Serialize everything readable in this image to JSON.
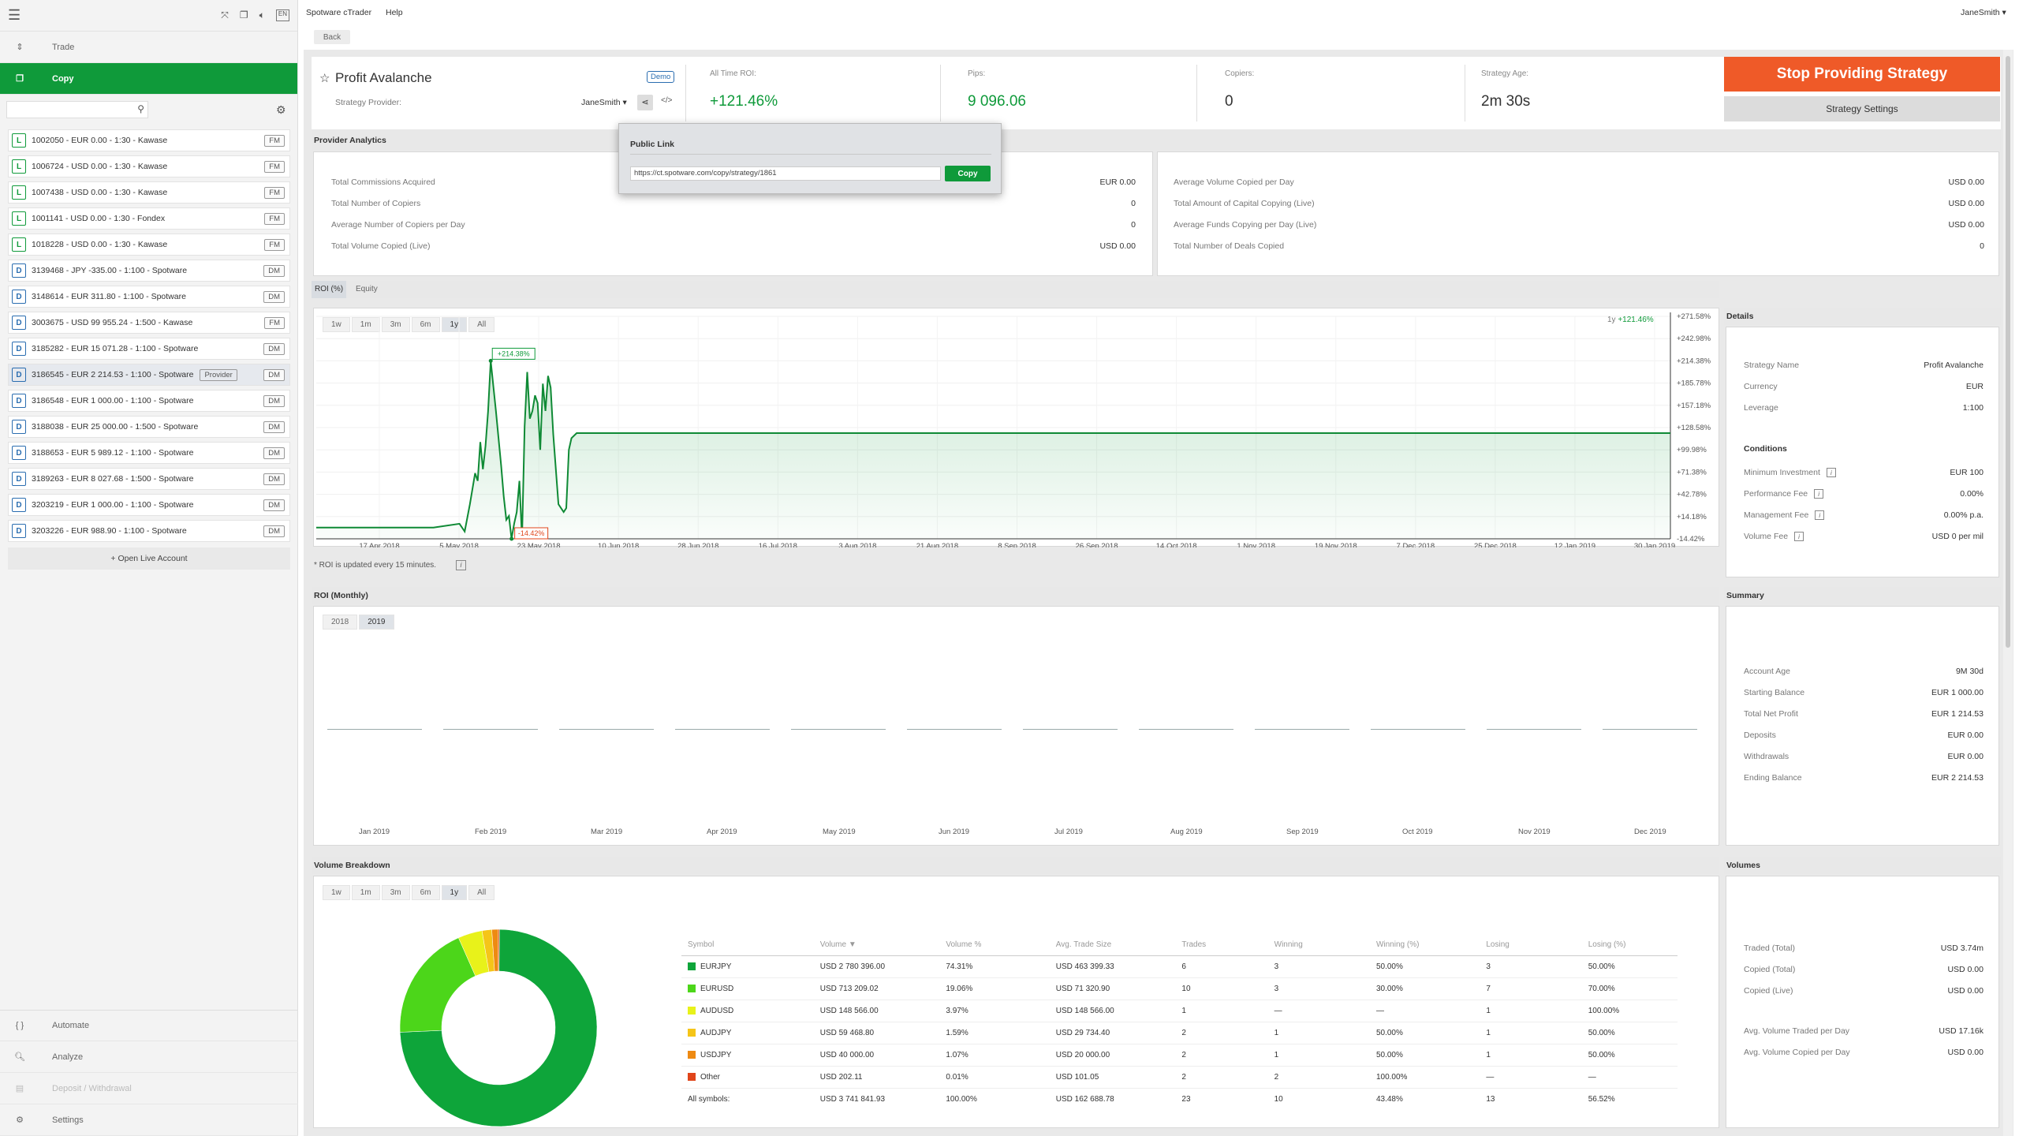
{
  "topbar": {
    "menu_app": "Spotware cTrader",
    "menu_help": "Help",
    "user": "JaneSmith"
  },
  "sidebar": {
    "nav": [
      {
        "label": "Trade"
      },
      {
        "label": "Copy"
      }
    ],
    "accounts": [
      {
        "type": "L",
        "label": "1002050 - EUR 0.00 - 1:30 - Kawase",
        "tag": "FM"
      },
      {
        "type": "L",
        "label": "1006724 - USD 0.00 - 1:30 - Kawase",
        "tag": "FM"
      },
      {
        "type": "L",
        "label": "1007438 - USD 0.00 - 1:30 - Kawase",
        "tag": "FM"
      },
      {
        "type": "L",
        "label": "1001141 - USD 0.00 - 1:30 - Fondex",
        "tag": "FM"
      },
      {
        "type": "L",
        "label": "1018228 - USD 0.00 - 1:30 - Kawase",
        "tag": "FM"
      },
      {
        "type": "D",
        "label": "3139468 - JPY -335.00 - 1:100 - Spotware",
        "tag": "DM"
      },
      {
        "type": "D",
        "label": "3148614 - EUR 311.80 - 1:100 - Spotware",
        "tag": "DM"
      },
      {
        "type": "D",
        "label": "3003675 - USD 99 955.24 - 1:500 - Kawase",
        "tag": "FM"
      },
      {
        "type": "D",
        "label": "3185282 - EUR 15 071.28 - 1:100 - Spotware",
        "tag": "DM"
      },
      {
        "type": "D",
        "label": "3186545 - EUR 2 214.53 - 1:100 - Spotware",
        "tag": "DM",
        "provider": "Provider"
      },
      {
        "type": "D",
        "label": "3186548 - EUR 1 000.00 - 1:100 - Spotware",
        "tag": "DM"
      },
      {
        "type": "D",
        "label": "3188038 - EUR 25 000.00 - 1:500 - Spotware",
        "tag": "DM"
      },
      {
        "type": "D",
        "label": "3188653 - EUR 5 989.12 - 1:100 - Spotware",
        "tag": "DM"
      },
      {
        "type": "D",
        "label": "3189263 - EUR 8 027.68 - 1:500 - Spotware",
        "tag": "DM"
      },
      {
        "type": "D",
        "label": "3203219 - EUR 1 000.00 - 1:100 - Spotware",
        "tag": "DM"
      },
      {
        "type": "D",
        "label": "3203226 - EUR 988.90 - 1:100 - Spotware",
        "tag": "DM"
      }
    ],
    "open_live": "+ Open Live Account",
    "bottom_nav": [
      {
        "label": "Automate"
      },
      {
        "label": "Analyze"
      },
      {
        "label": "Deposit / Withdrawal"
      },
      {
        "label": "Settings"
      }
    ]
  },
  "back": "Back",
  "header": {
    "title": "Profit Avalanche",
    "demo": "Demo",
    "provider_label": "Strategy Provider:",
    "provider_value": "JaneSmith",
    "roi_label": "All Time ROI:",
    "roi_value": "+121.46%",
    "pips_label": "Pips:",
    "pips_value": "9 096.06",
    "copiers_label": "Copiers:",
    "copiers_value": "0",
    "age_label": "Strategy Age:",
    "age_value": "2m 30s",
    "stop_btn": "Stop Providing Strategy",
    "settings_btn": "Strategy Settings"
  },
  "popup": {
    "title": "Public Link",
    "url": "https://ct.spotware.com/copy/strategy/1861",
    "copy": "Copy"
  },
  "analytics": {
    "title": "Provider Analytics",
    "left": [
      {
        "k": "Total Commissions Acquired",
        "v": "EUR 0.00"
      },
      {
        "k": "Total Number of Copiers",
        "v": "0"
      },
      {
        "k": "Average Number of Copiers per Day",
        "v": "0"
      },
      {
        "k": "Total Volume Copied (Live)",
        "v": "USD 0.00"
      }
    ],
    "right": [
      {
        "k": "Average Volume Copied per Day",
        "v": "USD 0.00"
      },
      {
        "k": "Total Amount of Capital Copying (Live)",
        "v": "USD 0.00"
      },
      {
        "k": "Average Funds Copying per Day (Live)",
        "v": "USD 0.00"
      },
      {
        "k": "Total Number of Deals Copied",
        "v": "0"
      }
    ]
  },
  "roi_chart": {
    "tabs": [
      "ROI (%)",
      "Equity"
    ],
    "ranges": [
      "1w",
      "1m",
      "3m",
      "6m",
      "1y",
      "All"
    ],
    "active_range": "1y",
    "legend": "1y",
    "legend_val": "+121.46%",
    "note": "* ROI is updated every 15 minutes.",
    "max_label": "+214.38%",
    "min_label": "-14.42%"
  },
  "chart_data": {
    "type": "line",
    "x_ticks": [
      "17 Apr 2018",
      "5 May 2018",
      "23 May 2018",
      "10 Jun 2018",
      "28 Jun 2018",
      "16 Jul 2018",
      "3 Aug 2018",
      "21 Aug 2018",
      "8 Sep 2018",
      "26 Sep 2018",
      "14 Oct 2018",
      "1 Nov 2018",
      "19 Nov 2018",
      "7 Dec 2018",
      "25 Dec 2018",
      "12 Jan 2019",
      "30 Jan 2019"
    ],
    "y_ticks": [
      "+271.58%",
      "+242.98%",
      "+214.38%",
      "+185.78%",
      "+157.18%",
      "+128.58%",
      "+99.98%",
      "+71.38%",
      "+42.78%",
      "+14.18%",
      "-14.42%"
    ],
    "ylim": [
      -14.42,
      271.58
    ],
    "series": [
      {
        "points": [
          [
            0,
            0
          ],
          [
            0.45,
            0
          ],
          [
            0.55,
            5
          ],
          [
            0.57,
            -5
          ],
          [
            0.59,
            30
          ],
          [
            0.61,
            70
          ],
          [
            0.62,
            60
          ],
          [
            0.63,
            110
          ],
          [
            0.64,
            75
          ],
          [
            0.65,
            105
          ],
          [
            0.66,
            150
          ],
          [
            0.67,
            214.38
          ],
          [
            0.69,
            150
          ],
          [
            0.71,
            80
          ],
          [
            0.72,
            40
          ],
          [
            0.73,
            10
          ],
          [
            0.74,
            15
          ],
          [
            0.75,
            -14.42
          ],
          [
            0.76,
            5
          ],
          [
            0.77,
            20
          ],
          [
            0.78,
            60
          ],
          [
            0.79,
            -14.42
          ],
          [
            0.8,
            130
          ],
          [
            0.81,
            200
          ],
          [
            0.82,
            140
          ],
          [
            0.83,
            150
          ],
          [
            0.84,
            170
          ],
          [
            0.85,
            160
          ],
          [
            0.86,
            100
          ],
          [
            0.87,
            185
          ],
          [
            0.88,
            150
          ],
          [
            0.89,
            195
          ],
          [
            0.9,
            180
          ],
          [
            0.91,
            120
          ],
          [
            0.93,
            30
          ],
          [
            0.95,
            20
          ],
          [
            0.96,
            25
          ],
          [
            0.97,
            100
          ],
          [
            0.98,
            115
          ],
          [
            1,
            121.46
          ],
          [
            5.2,
            121.46
          ]
        ]
      }
    ]
  },
  "details": {
    "title": "Details",
    "rows": [
      {
        "k": "Strategy Name",
        "v": "Profit Avalanche"
      },
      {
        "k": "Currency",
        "v": "EUR"
      },
      {
        "k": "Leverage",
        "v": "1:100"
      }
    ],
    "conditions_title": "Conditions",
    "conditions": [
      {
        "k": "Minimum Investment",
        "v": "EUR 100"
      },
      {
        "k": "Performance Fee",
        "v": "0.00%"
      },
      {
        "k": "Management Fee",
        "v": "0.00% p.a."
      },
      {
        "k": "Volume Fee",
        "v": "USD 0 per mil"
      }
    ]
  },
  "monthly": {
    "title": "ROI (Monthly)",
    "years": [
      "2018",
      "2019"
    ],
    "months": [
      "Jan 2019",
      "Feb 2019",
      "Mar 2019",
      "Apr 2019",
      "May 2019",
      "Jun 2019",
      "Jul 2019",
      "Aug 2019",
      "Sep 2019",
      "Oct 2019",
      "Nov 2019",
      "Dec 2019"
    ]
  },
  "summary": {
    "title": "Summary",
    "rows": [
      {
        "k": "Account Age",
        "v": "9M 30d"
      },
      {
        "k": "Starting Balance",
        "v": "EUR 1 000.00"
      },
      {
        "k": "Total Net Profit",
        "v": "EUR 1 214.53",
        "green": true
      },
      {
        "k": "Deposits",
        "v": "EUR 0.00"
      },
      {
        "k": "Withdrawals",
        "v": "EUR 0.00"
      },
      {
        "k": "Ending Balance",
        "v": "EUR 2 214.53"
      }
    ]
  },
  "volume": {
    "title": "Volume Breakdown",
    "ranges": [
      "1w",
      "1m",
      "3m",
      "6m",
      "1y",
      "All"
    ],
    "active_range": "1y",
    "headers": [
      "Symbol",
      "Volume ▼",
      "Volume %",
      "Avg. Trade Size",
      "Trades",
      "Winning",
      "Winning (%)",
      "Losing",
      "Losing (%)"
    ],
    "rows": [
      {
        "color": "#0ea53a",
        "cells": [
          "EURJPY",
          "USD 2 780 396.00",
          "74.31%",
          "USD 463 399.33",
          "6",
          "3",
          "50.00%",
          "3",
          "50.00%"
        ]
      },
      {
        "color": "#4cd61a",
        "cells": [
          "EURUSD",
          "USD 713 209.02",
          "19.06%",
          "USD 71 320.90",
          "10",
          "3",
          "30.00%",
          "7",
          "70.00%"
        ]
      },
      {
        "color": "#e8f21a",
        "cells": [
          "AUDUSD",
          "USD 148 566.00",
          "3.97%",
          "USD 148 566.00",
          "1",
          "—",
          "—",
          "1",
          "100.00%"
        ]
      },
      {
        "color": "#f5c518",
        "cells": [
          "AUDJPY",
          "USD 59 468.80",
          "1.59%",
          "USD 29 734.40",
          "2",
          "1",
          "50.00%",
          "1",
          "50.00%"
        ]
      },
      {
        "color": "#ee8a12",
        "cells": [
          "USDJPY",
          "USD 40 000.00",
          "1.07%",
          "USD 20 000.00",
          "2",
          "1",
          "50.00%",
          "1",
          "50.00%"
        ]
      },
      {
        "color": "#e0451a",
        "cells": [
          "Other",
          "USD 202.11",
          "0.01%",
          "USD 101.05",
          "2",
          "2",
          "100.00%",
          "—",
          "—"
        ]
      }
    ],
    "total": [
      "All symbols:",
      "USD 3 741 841.93",
      "100.00%",
      "USD 162 688.78",
      "23",
      "10",
      "43.48%",
      "13",
      "56.52%"
    ],
    "donut": [
      74.31,
      19.06,
      3.97,
      1.59,
      1.07,
      0.01
    ]
  },
  "volumes": {
    "title": "Volumes",
    "rows": [
      {
        "k": "Traded (Total)",
        "v": "USD 3.74m"
      },
      {
        "k": "Copied (Total)",
        "v": "USD 0.00"
      },
      {
        "k": "Copied (Live)",
        "v": "USD 0.00"
      },
      {
        "k": "Avg. Volume Traded per Day",
        "v": "USD 17.16k"
      },
      {
        "k": "Avg. Volume Copied per Day",
        "v": "USD 0.00"
      }
    ]
  }
}
